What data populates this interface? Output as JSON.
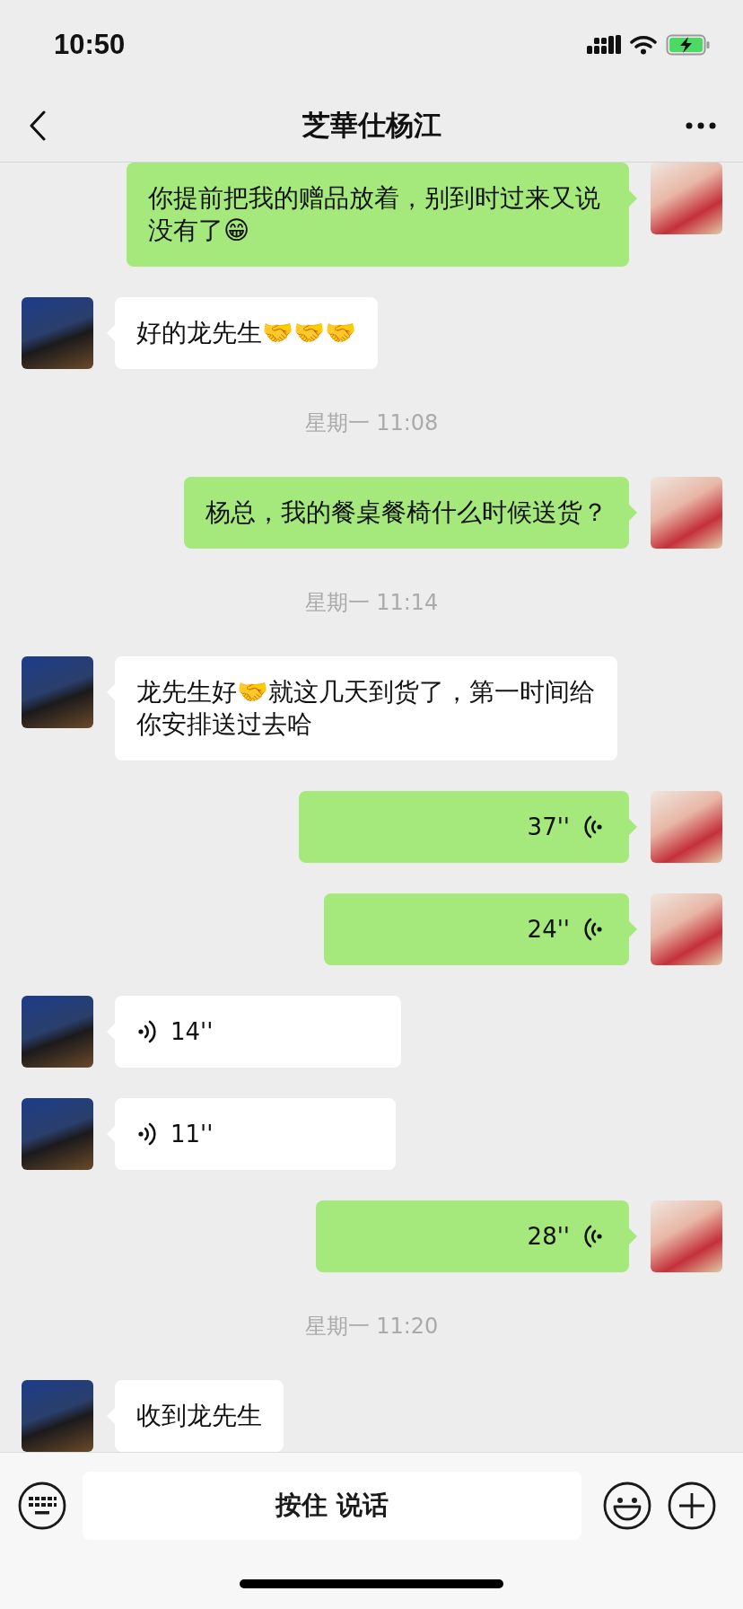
{
  "status_bar": {
    "time": "10:50"
  },
  "nav": {
    "title": "芝華仕杨江"
  },
  "messages": [
    {
      "kind": "text",
      "outgoing": true,
      "text": "你提前把我的赠品放着，别到时过来又说没有了😁"
    },
    {
      "kind": "text",
      "outgoing": false,
      "text": "好的龙先生🤝🤝🤝"
    },
    {
      "kind": "time",
      "text": "星期一 11:08"
    },
    {
      "kind": "text",
      "outgoing": true,
      "text": "杨总，我的餐桌餐椅什么时候送货？"
    },
    {
      "kind": "time",
      "text": "星期一 11:14"
    },
    {
      "kind": "text",
      "outgoing": false,
      "text": "龙先生好🤝就这几天到货了，第一时间给你安排送过去哈"
    },
    {
      "kind": "voice",
      "outgoing": true,
      "text": "37''"
    },
    {
      "kind": "voice",
      "outgoing": true,
      "text": "24''"
    },
    {
      "kind": "voice",
      "outgoing": false,
      "text": "14''"
    },
    {
      "kind": "voice",
      "outgoing": false,
      "text": "11''"
    },
    {
      "kind": "voice",
      "outgoing": true,
      "text": "28''"
    },
    {
      "kind": "time",
      "text": "星期一 11:20"
    },
    {
      "kind": "text",
      "outgoing": false,
      "text": "收到龙先生"
    }
  ],
  "input_bar": {
    "hold_to_talk": "按住 说话"
  }
}
